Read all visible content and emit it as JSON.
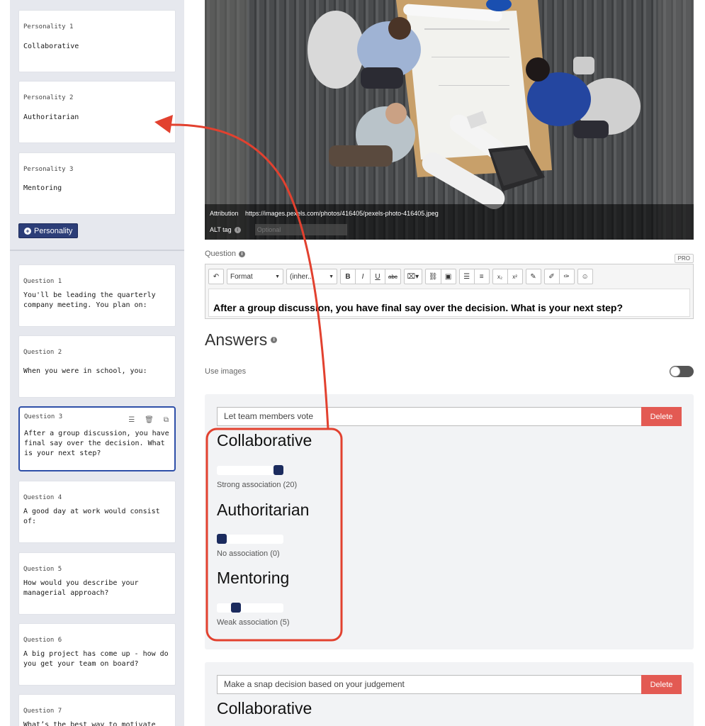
{
  "personalities": [
    {
      "label": "Personality 1",
      "name": "Collaborative"
    },
    {
      "label": "Personality 2",
      "name": "Authoritarian"
    },
    {
      "label": "Personality 3",
      "name": "Mentoring"
    }
  ],
  "add_personality_label": "Personality",
  "questions": [
    {
      "label": "Question 1",
      "text": "You'll be leading the quarterly company meeting. You plan on:"
    },
    {
      "label": "Question 2",
      "text": "When you were in school, you:"
    },
    {
      "label": "Question 3",
      "text": "After a group discussion, you have final say over the decision. What is your next step?"
    },
    {
      "label": "Question 4",
      "text": "A good day at work would consist of:"
    },
    {
      "label": "Question 5",
      "text": "How would you describe your managerial approach?"
    },
    {
      "label": "Question 6",
      "text": "A big project has come up - how do you get your team on board?"
    },
    {
      "label": "Question 7",
      "text": "What’s the best way to motivate"
    }
  ],
  "image": {
    "attribution_label": "Attribution",
    "attribution_url": "https://images.pexels.com/photos/416405/pexels-photo-416405.jpeg",
    "alt_label": "ALT tag",
    "alt_placeholder": "Optional"
  },
  "question_editor": {
    "label": "Question",
    "pro_badge": "PRO",
    "format_label": "Format",
    "font_label": "(inher...",
    "bold": "B",
    "italic": "I",
    "underline": "U",
    "strike": "abc",
    "subscript": "x₂",
    "superscript": "x²",
    "content": "After a group discussion, you have final say over the decision. What is your next step?"
  },
  "answers_title": "Answers",
  "use_images_label": "Use images",
  "delete_label": "Delete",
  "answers": [
    {
      "text": "Let team members vote",
      "associations": [
        {
          "name": "Collaborative",
          "value": 20,
          "max": 20,
          "label": "Strong association (20)"
        },
        {
          "name": "Authoritarian",
          "value": 0,
          "max": 20,
          "label": "No association (0)"
        },
        {
          "name": "Mentoring",
          "value": 5,
          "max": 20,
          "label": "Weak association (5)"
        }
      ]
    },
    {
      "text": "Make a snap decision based on your judgement",
      "associations": [
        {
          "name": "Collaborative"
        }
      ]
    }
  ],
  "colors": {
    "accent": "#2c3e78",
    "selected_border": "#2e4fa8",
    "delete": "#e35a53",
    "annotation": "#e2412f",
    "slider_thumb": "#1b2b5e"
  }
}
